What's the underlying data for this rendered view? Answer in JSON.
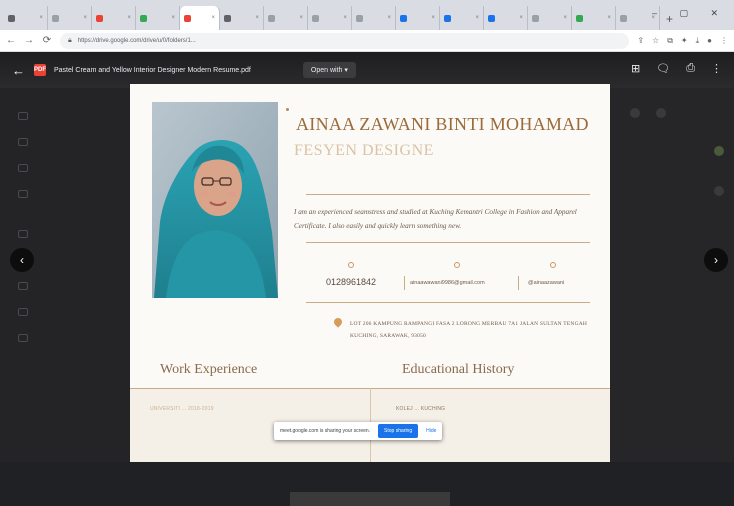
{
  "browser": {
    "tabs": [
      {
        "label": "",
        "color": "#5f6368"
      },
      {
        "label": "",
        "color": "#9aa0a6"
      },
      {
        "label": "",
        "color": "#ea4335"
      },
      {
        "label": "",
        "color": "#34a853"
      },
      {
        "label": "",
        "color": "#ea4335",
        "active": true
      },
      {
        "label": "",
        "color": "#5f6368"
      },
      {
        "label": "",
        "color": "#9aa0a6"
      },
      {
        "label": "",
        "color": "#9aa0a6"
      },
      {
        "label": "",
        "color": "#9aa0a6"
      },
      {
        "label": "",
        "color": "#1a73e8"
      },
      {
        "label": "",
        "color": "#1a73e8"
      },
      {
        "label": "",
        "color": "#1a73e8"
      },
      {
        "label": "",
        "color": "#9aa0a6"
      },
      {
        "label": "",
        "color": "#34a853"
      },
      {
        "label": "",
        "color": "#9aa0a6"
      }
    ],
    "new_tab": "+",
    "window_controls": "–  ▢  ✕",
    "url": "https://drive.google.com/drive/u/0/folders/1...",
    "lock_icon": "lock-icon"
  },
  "viewer": {
    "file_title": "Pastel Cream and Yellow Interior Designer Modern Resume.pdf",
    "pdf_badge": "PDF",
    "open_with": "Open with ▾",
    "sidebar_items": [
      "",
      "",
      "",
      "",
      "",
      "",
      "",
      "",
      ""
    ]
  },
  "resume": {
    "name": "AINAA ZAWANI BINTI MOHAMAD",
    "role": "FESYEN DESIGNE",
    "summary": "I am an experienced seamstress and studied at Kuching Kemantri College in Fashion and Apparel Certificate. I also easily and quickly learn something new.",
    "phone": "0128961842",
    "email": "ainaawawani9986@gmail.com",
    "social": "@ainaazawani",
    "address": "LOT 206 KAMPUNG RAMPANGI FASA 2 LORONG MERBAU 7A1 JALAN SULTAN TENGAH KUCHING, SARAWAK, 93050",
    "work_title": "Work Experience",
    "edu_title": "Educational History",
    "work_faint": "UNIVERSITI ... 2018-2019",
    "edu_faint": "KOLEJ ... KUCHING"
  },
  "share_bar": {
    "text": "meet.google.com is sharing your screen.",
    "stop": "Stop sharing",
    "hide": "Hide"
  },
  "colors": {
    "accent_brown": "#9a6a3a",
    "accent_light": "#d9c3a5",
    "photo_teal": "#2f9aa8"
  }
}
